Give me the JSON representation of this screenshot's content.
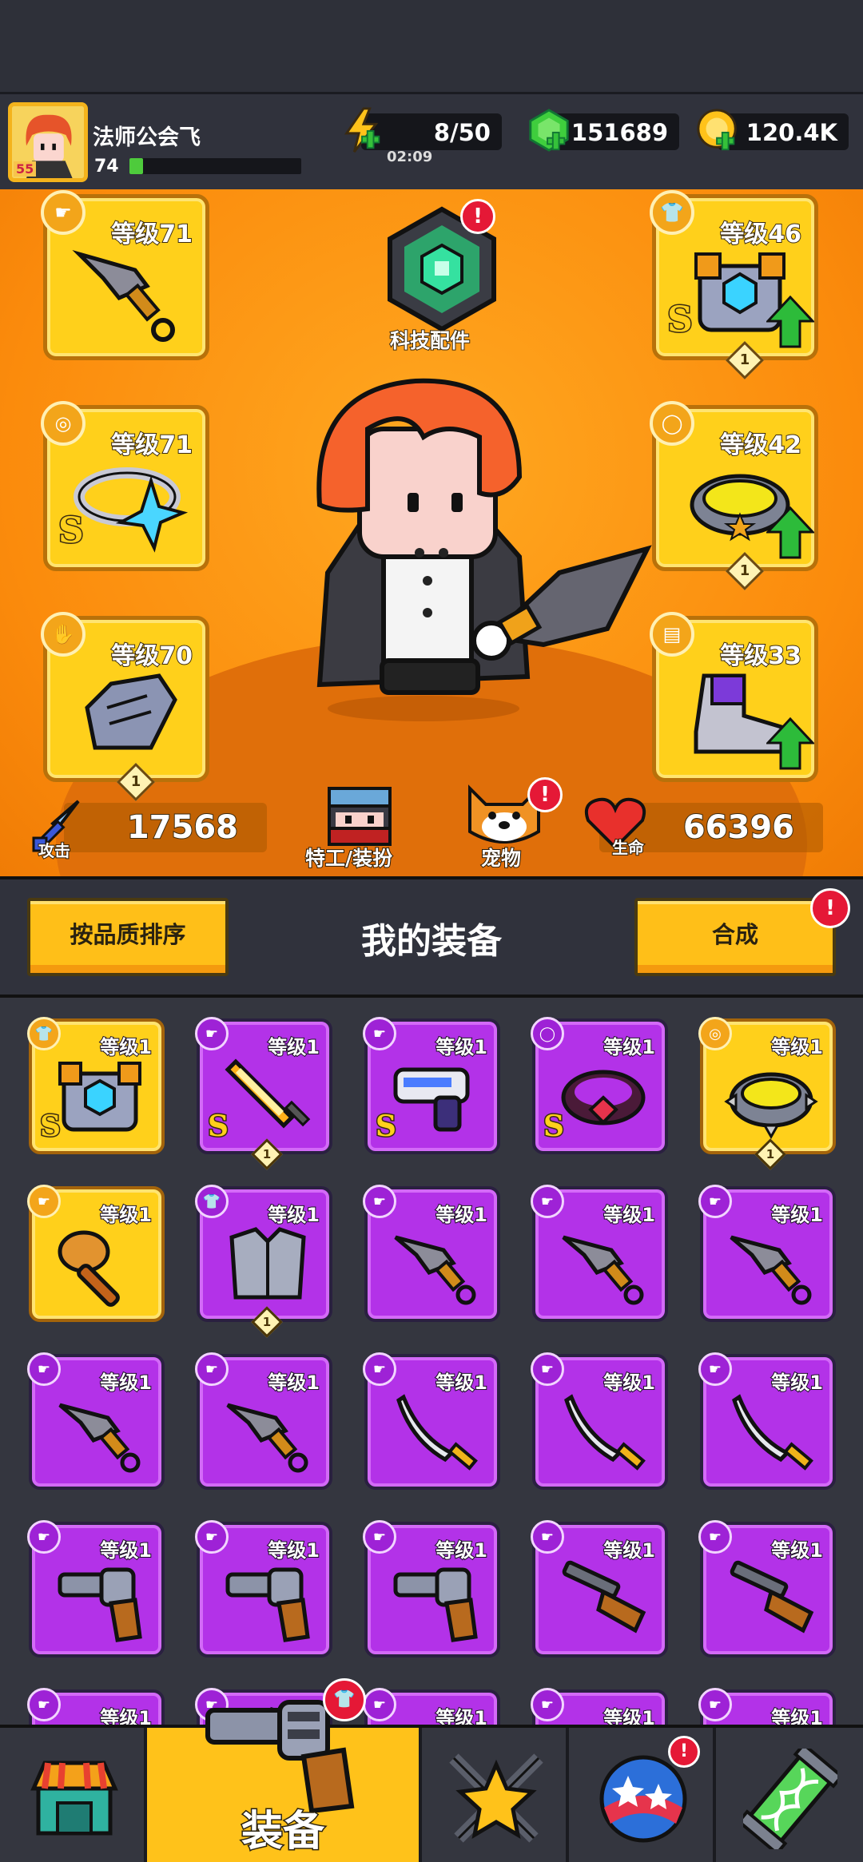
{
  "player": {
    "name": "法师公会飞",
    "avatar_badge": "55",
    "level": "74",
    "xp_fraction": 0.08
  },
  "resources": {
    "energy": "8/50",
    "energy_timer": "02:09",
    "gems": "151689",
    "gold": "120.4K"
  },
  "equipped": {
    "weapon": {
      "level": "等级71",
      "icon": "kunai-icon"
    },
    "necklace": {
      "level": "等级71",
      "grade": "S",
      "icon": "star-necklace-icon"
    },
    "gloves": {
      "level": "等级70",
      "gem_count": "1",
      "icon": "gauntlet-icon"
    },
    "armor": {
      "level": "等级46",
      "grade": "S",
      "gem_count": "1",
      "icon": "robot-armor-icon"
    },
    "belt": {
      "level": "等级42",
      "gem_count": "1",
      "icon": "belt-icon"
    },
    "boots": {
      "level": "等级33",
      "icon": "sneaker-icon"
    }
  },
  "tech": {
    "label": "科技配件",
    "badge": "!"
  },
  "stats": {
    "attack_label": "攻击",
    "attack": "17568",
    "hp_label": "生命",
    "hp": "66396"
  },
  "shortcuts": {
    "agent": "特工/装扮",
    "pet": "宠物",
    "pet_badge": "!"
  },
  "toolbar": {
    "sort_label": "按品质排序",
    "title": "我的装备",
    "merge_label": "合成",
    "merge_badge": "!"
  },
  "inventory": [
    {
      "level": "等级1",
      "grade": "S",
      "rarity": "gold",
      "icon": "robot-armor-icon",
      "type": "armor"
    },
    {
      "level": "等级1",
      "grade": "S",
      "rarity": "purple",
      "icon": "flame-sword-icon",
      "type": "weapon",
      "gem": "1"
    },
    {
      "level": "等级1",
      "grade": "S",
      "rarity": "purple",
      "icon": "blaster-icon",
      "type": "weapon"
    },
    {
      "level": "等级1",
      "grade": "S",
      "rarity": "purple",
      "icon": "ruby-belt-icon",
      "type": "belt"
    },
    {
      "level": "等级1",
      "grade": "",
      "rarity": "gold",
      "icon": "spiked-ring-icon",
      "type": "necklace",
      "gem": "1"
    },
    {
      "level": "等级1",
      "grade": "",
      "rarity": "gold",
      "icon": "bat-icon",
      "type": "weapon"
    },
    {
      "level": "等级1",
      "grade": "",
      "rarity": "purple",
      "icon": "plate-armor-icon",
      "type": "armor",
      "gem": "1"
    },
    {
      "level": "等级1",
      "grade": "",
      "rarity": "purple",
      "icon": "kunai-icon",
      "type": "weapon"
    },
    {
      "level": "等级1",
      "grade": "",
      "rarity": "purple",
      "icon": "kunai-icon",
      "type": "weapon"
    },
    {
      "level": "等级1",
      "grade": "",
      "rarity": "purple",
      "icon": "kunai-icon",
      "type": "weapon"
    },
    {
      "level": "等级1",
      "grade": "",
      "rarity": "purple",
      "icon": "kunai-icon",
      "type": "weapon"
    },
    {
      "level": "等级1",
      "grade": "",
      "rarity": "purple",
      "icon": "kunai-icon",
      "type": "weapon"
    },
    {
      "level": "等级1",
      "grade": "",
      "rarity": "purple",
      "icon": "katana-icon",
      "type": "weapon"
    },
    {
      "level": "等级1",
      "grade": "",
      "rarity": "purple",
      "icon": "katana-icon",
      "type": "weapon"
    },
    {
      "level": "等级1",
      "grade": "",
      "rarity": "purple",
      "icon": "katana-icon",
      "type": "weapon"
    },
    {
      "level": "等级1",
      "grade": "",
      "rarity": "purple",
      "icon": "revolver-icon",
      "type": "weapon"
    },
    {
      "level": "等级1",
      "grade": "",
      "rarity": "purple",
      "icon": "revolver-icon",
      "type": "weapon"
    },
    {
      "level": "等级1",
      "grade": "",
      "rarity": "purple",
      "icon": "revolver-icon",
      "type": "weapon"
    },
    {
      "level": "等级1",
      "grade": "",
      "rarity": "purple",
      "icon": "shotgun-icon",
      "type": "weapon"
    },
    {
      "level": "等级1",
      "grade": "",
      "rarity": "purple",
      "icon": "shotgun-icon",
      "type": "weapon"
    },
    {
      "level": "等级1",
      "grade": "",
      "rarity": "purple",
      "icon": "",
      "type": "weapon"
    },
    {
      "level": "等级1",
      "grade": "",
      "rarity": "purple",
      "icon": "",
      "type": "weapon"
    },
    {
      "level": "等级1",
      "grade": "",
      "rarity": "purple",
      "icon": "",
      "type": "weapon"
    },
    {
      "level": "等级1",
      "grade": "",
      "rarity": "purple",
      "icon": "",
      "type": "weapon"
    },
    {
      "level": "等级1",
      "grade": "",
      "rarity": "purple",
      "icon": "",
      "type": "weapon"
    }
  ],
  "nav": {
    "shop_icon": "shop-icon",
    "equipment_label": "装备",
    "equipment_icon": "revolver-icon",
    "battle_icon": "crossed-swords-star-icon",
    "events_icon": "star-orb-icon",
    "events_badge": "!",
    "lab_icon": "dna-tube-icon"
  },
  "colors": {
    "accent_gold": "#ffc21a",
    "rare_purple": "#b332e8",
    "stage_orange": "#fb8b0c",
    "alert_red": "#e51836",
    "up_green": "#2dbb3a"
  }
}
